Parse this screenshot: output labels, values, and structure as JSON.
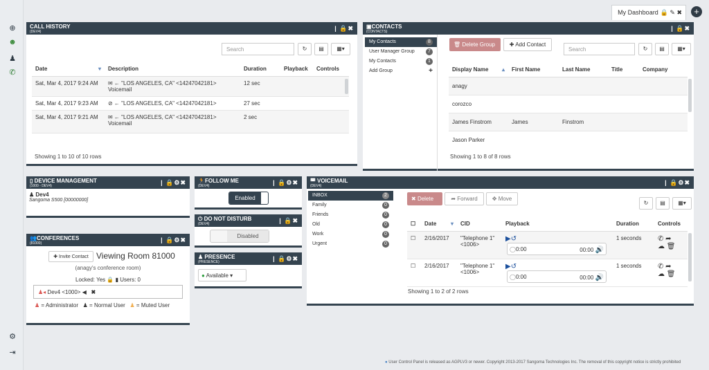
{
  "dashboard_tab": {
    "label": "My Dashboard",
    "icons": "🔒 ✎ ✖"
  },
  "call_history": {
    "title": "CALL HISTORY",
    "subtitle": "(DEV4)",
    "search_placeholder": "Search",
    "columns": [
      "Date",
      "Description",
      "Duration",
      "Playback",
      "Controls"
    ],
    "rows": [
      {
        "date": "Sat, Mar 4, 2017 9:24 AM",
        "desc_icons": "✉ ←",
        "desc": "\"LOS ANGELES, CA\" <14247042181>",
        "desc2": "Voicemail",
        "duration": "12 sec"
      },
      {
        "date": "Sat, Mar 4, 2017 9:23 AM",
        "desc_icons": "⊘ ←",
        "desc": "\"LOS ANGELES, CA\" <14247042181>",
        "desc2": "",
        "duration": "27 sec"
      },
      {
        "date": "Sat, Mar 4, 2017 9:21 AM",
        "desc_icons": "✉ ←",
        "desc": "\"LOS ANGELES, CA\" <14247042181>",
        "desc2": "Voicemail",
        "duration": "2 sec"
      }
    ],
    "footer": "Showing 1 to 10 of 10 rows"
  },
  "contacts": {
    "title": "CONTACTS",
    "subtitle": "(CONTACTS)",
    "groups": [
      {
        "label": "My Contacts",
        "count": "8"
      },
      {
        "label": "User Manager Group",
        "count": "7"
      },
      {
        "label": "My Contacts",
        "count": "1"
      },
      {
        "label": "Add Group",
        "count": "+"
      }
    ],
    "delete_group": "Delete Group",
    "add_contact": "Add Contact",
    "search_placeholder": "Search",
    "columns": [
      "Display Name",
      "First Name",
      "Last Name",
      "Title",
      "Company"
    ],
    "rows": [
      {
        "display": "anagy",
        "first": "",
        "last": ""
      },
      {
        "display": "corozco",
        "first": "",
        "last": ""
      },
      {
        "display": "James Finstrom",
        "first": "James",
        "last": "Finstrom"
      },
      {
        "display": "Jason Parker",
        "first": "",
        "last": ""
      }
    ],
    "footer": "Showing 1 to 8 of 8 rows"
  },
  "device_mgmt": {
    "title": "DEVICE MANAGEMENT",
    "subtitle": "(1000 - DEV4)",
    "device_name": "Dev4",
    "device_model": "Sangoma S500 [00000000]"
  },
  "follow_me": {
    "title": "FOLLOW ME",
    "subtitle": "(DEV4)",
    "state": "Enabled"
  },
  "dnd": {
    "title": "DO NOT DISTURB",
    "subtitle": "(DEV4)",
    "state": "Disabled"
  },
  "presence": {
    "title": "PRESENCE",
    "subtitle": "(PRESENCE)",
    "state": "Available"
  },
  "conferences": {
    "title": "CONFERENCES",
    "subtitle": "(81000)",
    "invite": "Invite Contact",
    "room": "Viewing Room 81000",
    "room_sub": "(anagy's conference room)",
    "locked": "Locked: Yes",
    "users": "Users: 0",
    "participant": "Dev4 <1000>",
    "legend_admin": "= Administrator",
    "legend_normal": "= Normal User",
    "legend_muted": "= Muted User"
  },
  "voicemail": {
    "title": "VOICEMAIL",
    "subtitle": "(DEV4)",
    "folders": [
      {
        "label": "INBOX",
        "count": "2"
      },
      {
        "label": "Family",
        "count": "0"
      },
      {
        "label": "Friends",
        "count": "0"
      },
      {
        "label": "Old",
        "count": "0"
      },
      {
        "label": "Work",
        "count": "0"
      },
      {
        "label": "Urgent",
        "count": "0"
      }
    ],
    "delete": "Delete",
    "forward": "Forward",
    "move": "Move",
    "columns": [
      "Date",
      "CID",
      "Playback",
      "Duration",
      "Controls"
    ],
    "rows": [
      {
        "date": "2/16/2017",
        "cid": "\"Telephone 1\" <1006>",
        "t1": "0:00",
        "t2": "00:00",
        "duration": "1 seconds"
      },
      {
        "date": "2/16/2017",
        "cid": "\"Telephone 1\" <1006>",
        "t1": "0:00",
        "t2": "00:00",
        "duration": "1 seconds"
      }
    ],
    "footer": "Showing 1 to 2 of 2 rows"
  },
  "copyright": "User Control Panel is released as AGPLV3 or newer. Copyright 2013-2017 Sangoma Technologies Inc. The removal of this copyright notice is strictly prohibited"
}
